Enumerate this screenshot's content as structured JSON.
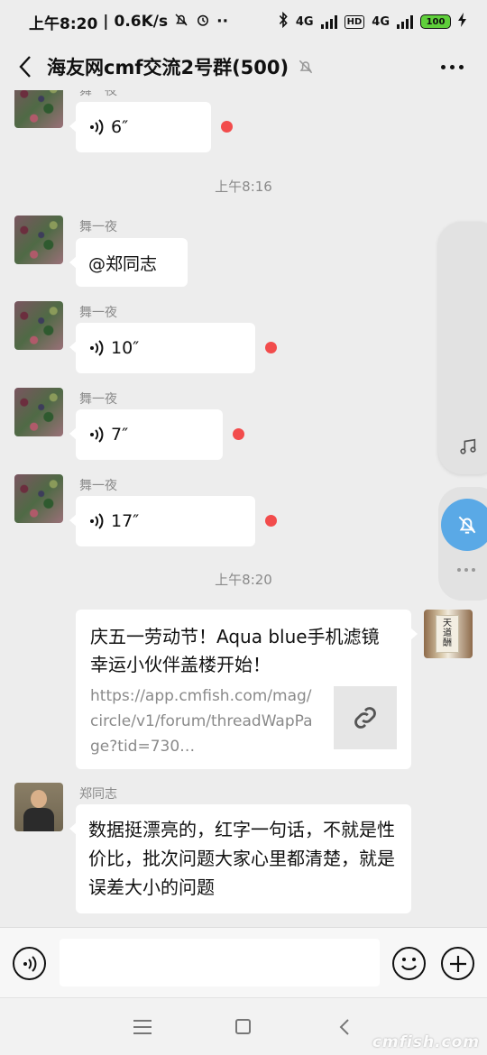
{
  "status_bar": {
    "time": "上午8:20",
    "speed": "0.6K/s",
    "net1": "4G",
    "hd": "HD",
    "net2": "4G",
    "battery": "100"
  },
  "header": {
    "title": "海友网cmf交流2号群(500)"
  },
  "messages": {
    "m0": {
      "sender": "舞一夜",
      "duration": "6″"
    },
    "ts1": "上午8:16",
    "m1": {
      "sender": "舞一夜",
      "text": "@郑同志"
    },
    "m2": {
      "sender": "舞一夜",
      "duration": "10″"
    },
    "m3": {
      "sender": "舞一夜",
      "duration": "7″"
    },
    "m4": {
      "sender": "舞一夜",
      "duration": "17″"
    },
    "ts2": "上午8:20",
    "card": {
      "title": "庆五一劳动节！Aqua blue手机滤镜幸运小伙伴盖楼开始！",
      "url": "https://app.cmfish.com/mag/circle/v1/forum/threadWapPage?tid=730…"
    },
    "m6": {
      "sender": "郑同志",
      "text": "数据挺漂亮的，红字一句话，不就是性价比，批次问题大家心里都清楚，就是误差大小的问题"
    }
  },
  "input": {
    "value": ""
  },
  "watermark": "cmfish.com",
  "colors": {
    "unread": "#f24c4c",
    "float_button": "#5aa9e6",
    "background": "#ededed"
  }
}
